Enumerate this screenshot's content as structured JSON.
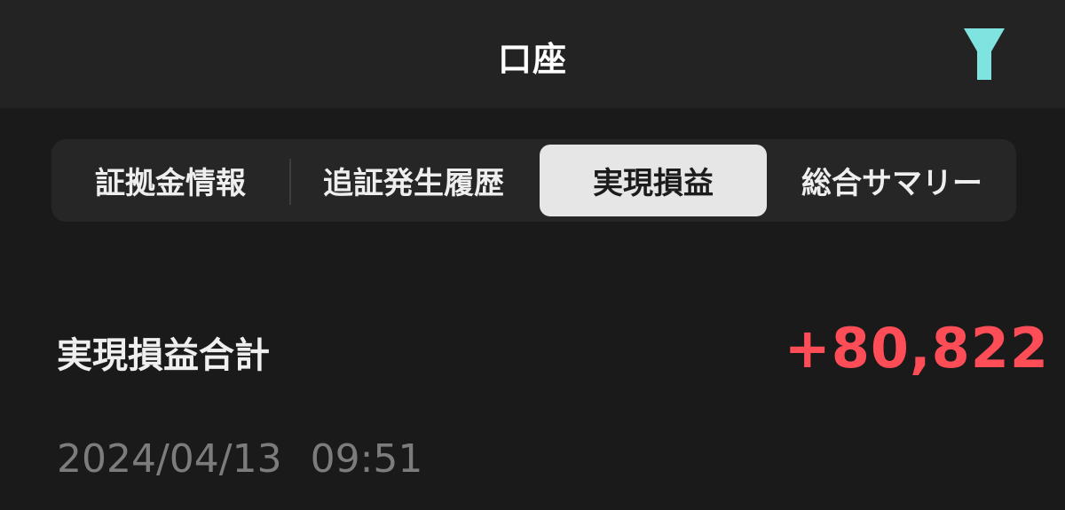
{
  "header": {
    "title": "口座",
    "filter_icon": "filter-icon",
    "filter_color": "#7fe3df"
  },
  "tabs": [
    {
      "label": "証拠金情報",
      "selected": false
    },
    {
      "label": "追証発生履歴",
      "selected": false
    },
    {
      "label": "実現損益",
      "selected": true
    },
    {
      "label": "総合サマリー",
      "selected": false
    }
  ],
  "summary": {
    "label": "実現損益合計",
    "value": "+80,822",
    "value_color": "#ff4d57"
  },
  "timestamp": {
    "date": "2024/04/13",
    "time": "09:51"
  }
}
